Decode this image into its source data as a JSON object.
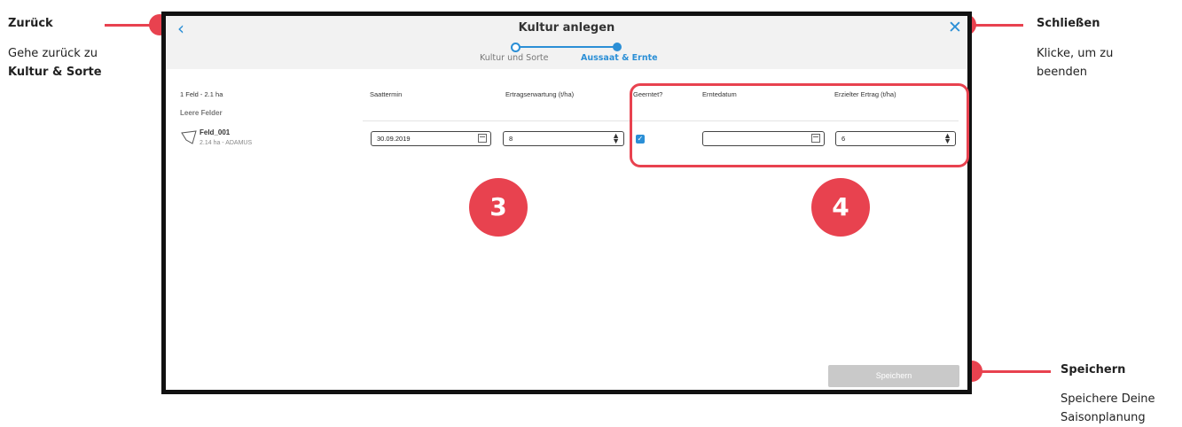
{
  "annotations": {
    "back": {
      "title": "Zurück",
      "line1": "Gehe zurück zu",
      "line2_bold": "Kultur & Sorte"
    },
    "close": {
      "title": "Schließen",
      "line1": "Klicke, um zu",
      "line2": "beenden"
    },
    "save": {
      "title": "Speichern",
      "line1": "Speichere Deine",
      "line2": "Saisonplanung"
    },
    "badge_3": "3",
    "badge_4": "4",
    "accent_color": "#e8424f"
  },
  "dialog": {
    "title": "Kultur anlegen",
    "back_icon": "chevron-left-icon",
    "close_icon": "close-icon",
    "steps": [
      {
        "label": "Kultur und Sorte",
        "state": "done"
      },
      {
        "label": "Aussaat & Ernte",
        "state": "active"
      }
    ],
    "columns": {
      "fields_summary": "1 Feld - 2.1 ha",
      "sowing_date": "Saattermin",
      "expected_yield": "Ertragserwartung (t/ha)",
      "harvested": "Geerntet?",
      "harvest_date": "Erntedatum",
      "achieved_yield": "Erzielter Ertrag (t/ha)"
    },
    "section_label": "Leere Felder",
    "row": {
      "field_name": "Feld_001",
      "field_info": "2.14 ha - ADAMUS",
      "sowing_date": "30.09.2019",
      "expected_yield": "8",
      "harvested": true,
      "harvest_date": "",
      "achieved_yield": "6"
    },
    "save_label": "Speichern",
    "accent_color": "#2b8fd6"
  }
}
